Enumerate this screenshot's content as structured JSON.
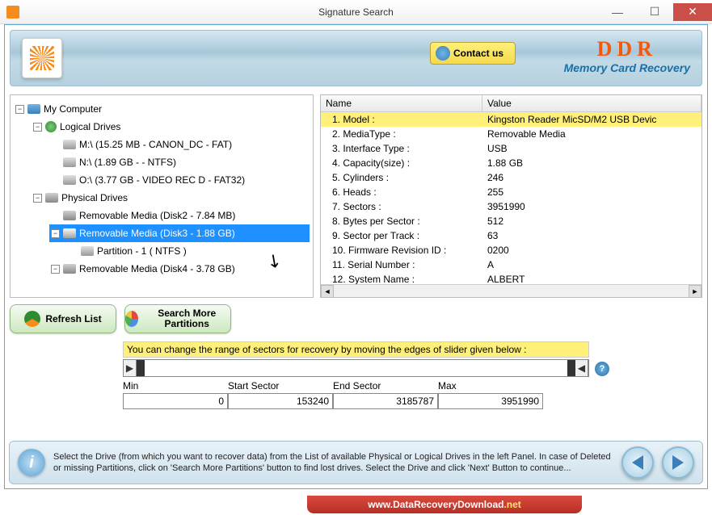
{
  "window": {
    "title": "Signature Search"
  },
  "header": {
    "contact_label": "Contact us",
    "brand": "DDR",
    "brand_sub": "Memory Card Recovery"
  },
  "tree": {
    "root": "My Computer",
    "logical_label": "Logical Drives",
    "logical": [
      "M:\\ (15.25 MB - CANON_DC - FAT)",
      "N:\\ (1.89 GB -  - NTFS)",
      "O:\\ (3.77 GB - VIDEO REC D - FAT32)"
    ],
    "physical_label": "Physical Drives",
    "physical": [
      "Removable Media (Disk2 - 7.84 MB)",
      "Removable Media (Disk3 - 1.88 GB)",
      "Partition - 1 ( NTFS )",
      "Removable Media (Disk4 - 3.78 GB)"
    ],
    "selected_index": 1
  },
  "properties": {
    "header_name": "Name",
    "header_value": "Value",
    "rows": [
      {
        "name": "1. Model :",
        "value": "Kingston Reader  MicSD/M2 USB Devic",
        "hl": true
      },
      {
        "name": "2. MediaType :",
        "value": "Removable Media"
      },
      {
        "name": "3. Interface Type :",
        "value": "USB"
      },
      {
        "name": "4. Capacity(size) :",
        "value": "1.88 GB"
      },
      {
        "name": "5. Cylinders :",
        "value": "246"
      },
      {
        "name": "6. Heads :",
        "value": "255"
      },
      {
        "name": "7. Sectors :",
        "value": "3951990"
      },
      {
        "name": "8. Bytes per Sector :",
        "value": "512"
      },
      {
        "name": "9. Sector per Track :",
        "value": "63"
      },
      {
        "name": "10. Firmware Revision ID :",
        "value": "0200"
      },
      {
        "name": "11. Serial Number :",
        "value": "A"
      },
      {
        "name": "12. System Name :",
        "value": "ALBERT"
      }
    ]
  },
  "buttons": {
    "refresh": "Refresh List",
    "search_more": "Search More\nPartitions"
  },
  "slider": {
    "hint": "You can change the range of sectors for recovery by moving the edges of slider given below :",
    "min_label": "Min",
    "start_label": "Start Sector",
    "end_label": "End Sector",
    "max_label": "Max",
    "min": "0",
    "start": "153240",
    "end": "3185787",
    "max": "3951990"
  },
  "footer": {
    "text": "Select the Drive (from which you want to recover data) from the List of available Physical or Logical Drives in the left Panel. In case of Deleted or missing Partitions, click on 'Search More Partitions' button to find lost drives. Select the Drive and click 'Next' Button to continue..."
  },
  "url": {
    "www": "www.",
    "domain": "DataRecoveryDownload",
    "tld": ".net"
  }
}
